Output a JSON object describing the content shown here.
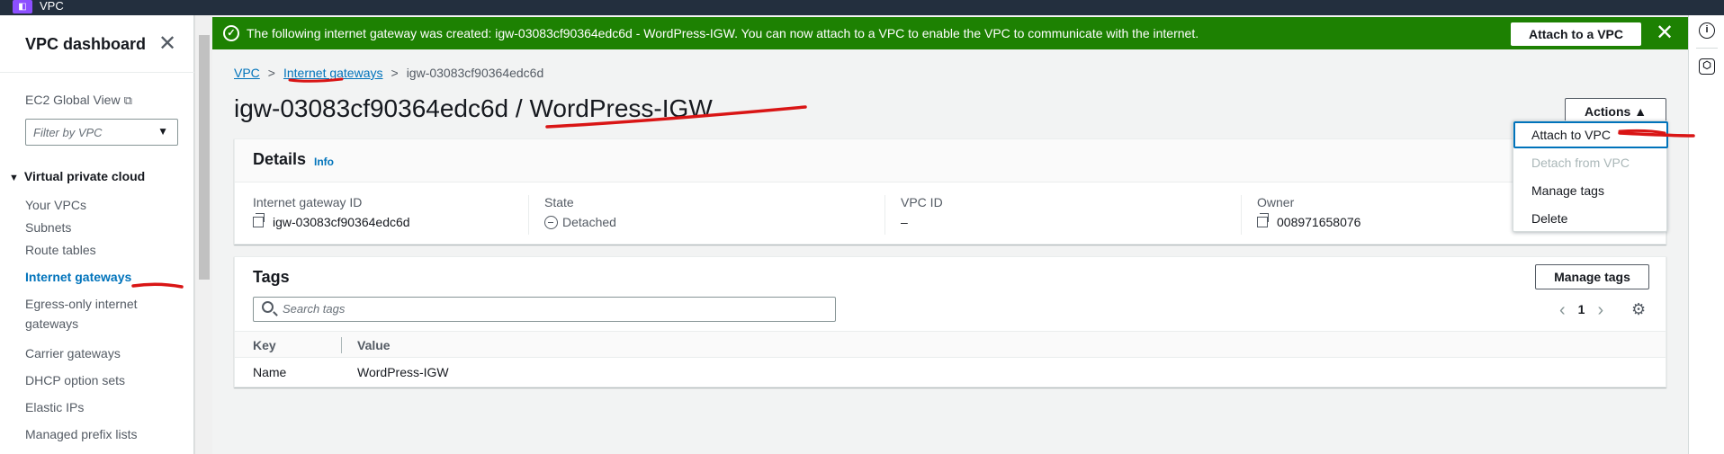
{
  "topbar": {
    "service_name": "VPC"
  },
  "sidebar": {
    "title": "VPC dashboard",
    "ec2_global_view": "EC2 Global View",
    "filter_placeholder": "Filter by VPC",
    "section_label": "Virtual private cloud",
    "items": [
      {
        "label": "Your VPCs"
      },
      {
        "label": "Subnets"
      },
      {
        "label": "Route tables"
      },
      {
        "label": "Internet gateways"
      },
      {
        "label": "Egress-only internet"
      },
      {
        "label": "gateways"
      },
      {
        "label": "Carrier gateways"
      },
      {
        "label": "DHCP option sets"
      },
      {
        "label": "Elastic IPs"
      },
      {
        "label": "Managed prefix lists"
      }
    ]
  },
  "flash": {
    "message": "The following internet gateway was created: igw-03083cf90364edc6d - WordPress-IGW. You can now attach to a VPC to enable the VPC to communicate with the internet.",
    "action_label": "Attach to a VPC"
  },
  "breadcrumb": {
    "vpc": "VPC",
    "internet_gateways": "Internet gateways",
    "current": "igw-03083cf90364edc6d"
  },
  "page_title": "igw-03083cf90364edc6d / WordPress-IGW",
  "actions": {
    "label": "Actions",
    "menu": {
      "attach": "Attach to VPC",
      "detach": "Detach from VPC",
      "manage_tags": "Manage tags",
      "delete": "Delete"
    }
  },
  "details": {
    "title": "Details",
    "info": "Info",
    "gateway_id_label": "Internet gateway ID",
    "gateway_id": "igw-03083cf90364edc6d",
    "state_label": "State",
    "state": "Detached",
    "vpc_id_label": "VPC ID",
    "vpc_id": "–",
    "owner_label": "Owner",
    "owner": "008971658076"
  },
  "tags": {
    "title": "Tags",
    "manage_tags": "Manage tags",
    "search_placeholder": "Search tags",
    "page": "1",
    "col_key": "Key",
    "col_value": "Value",
    "rows": [
      {
        "key": "Name",
        "value": "WordPress-IGW"
      }
    ]
  },
  "colors": {
    "success": "#1d8102",
    "link": "#0073bb",
    "annotation": "#d91515"
  }
}
